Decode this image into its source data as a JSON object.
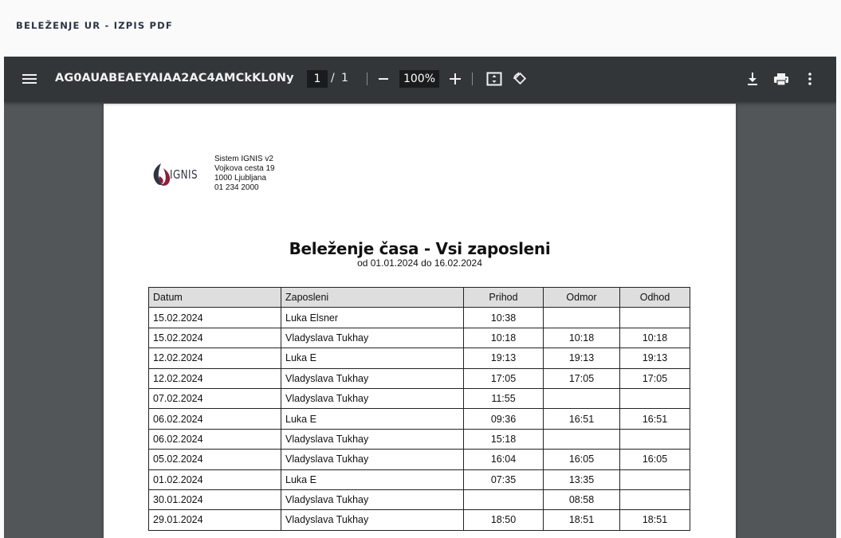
{
  "page": {
    "title": "BELEŽENJE UR - IZPIS PDF"
  },
  "viewer": {
    "filename": "AG0AUABEAEYAIAA2AC4AMCkKL0NyZWF...",
    "current_page": "1",
    "page_separator": "/",
    "total_pages": "1",
    "zoom": "100%",
    "icons": [
      "menu-icon",
      "zoom-out-icon",
      "zoom-in-icon",
      "fit-to-page-icon",
      "rotate-icon",
      "download-icon",
      "print-icon",
      "more-vert-icon"
    ],
    "colors": {
      "toolbar": "#323639",
      "background": "#525659"
    }
  },
  "document": {
    "logo_text": "IGNIS",
    "company": {
      "name": "Sistem IGNIS v2",
      "street": "Vojkova cesta 19",
      "city": "1000 Ljubljana",
      "phone": "01 234 2000"
    },
    "title": "Beleženje časa - Vsi zaposleni",
    "subtitle": "od 01.01.2024 do 16.02.2024",
    "table": {
      "headers": [
        "Datum",
        "Zaposleni",
        "Prihod",
        "Odmor",
        "Odhod"
      ],
      "rows": [
        [
          "15.02.2024",
          "Luka Elsner",
          "10:38",
          "",
          ""
        ],
        [
          "15.02.2024",
          "Vladyslava Tukhay",
          "10:18",
          "10:18",
          "10:18"
        ],
        [
          "12.02.2024",
          "Luka E",
          "19:13",
          "19:13",
          "19:13"
        ],
        [
          "12.02.2024",
          "Vladyslava Tukhay",
          "17:05",
          "17:05",
          "17:05"
        ],
        [
          "07.02.2024",
          "Vladyslava Tukhay",
          "11:55",
          "",
          ""
        ],
        [
          "06.02.2024",
          "Luka E",
          "09:36",
          "16:51",
          "16:51"
        ],
        [
          "06.02.2024",
          "Vladyslava Tukhay",
          "15:18",
          "",
          ""
        ],
        [
          "05.02.2024",
          "Vladyslava Tukhay",
          "16:04",
          "16:05",
          "16:05"
        ],
        [
          "01.02.2024",
          "Luka E",
          "07:35",
          "13:35",
          ""
        ],
        [
          "30.01.2024",
          "Vladyslava Tukhay",
          "",
          "08:58",
          ""
        ],
        [
          "29.01.2024",
          "Vladyslava Tukhay",
          "18:50",
          "18:51",
          "18:51"
        ]
      ]
    }
  }
}
